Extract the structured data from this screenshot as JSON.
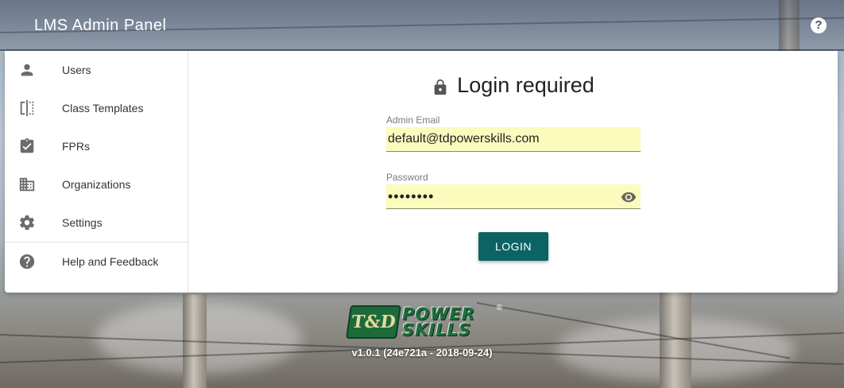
{
  "app": {
    "title": "LMS Admin Panel"
  },
  "header": {
    "help_icon": "help-circle-icon"
  },
  "sidebar": {
    "items": [
      {
        "label": "Users",
        "icon": "person-icon"
      },
      {
        "label": "Class Templates",
        "icon": "template-icon"
      },
      {
        "label": "FPRs",
        "icon": "clipboard-check-icon"
      },
      {
        "label": "Organizations",
        "icon": "building-icon"
      },
      {
        "label": "Settings",
        "icon": "gear-icon"
      }
    ],
    "footer_item": {
      "label": "Help and Feedback",
      "icon": "help-circle-icon"
    }
  },
  "login": {
    "title": "Login required",
    "email_label": "Admin Email",
    "email_value": "default@tdpowerskills.com",
    "password_label": "Password",
    "password_value": "••••••••",
    "button_label": "LOGIN"
  },
  "brand": {
    "mark": "T&D",
    "line1": "POWER",
    "line2": "SKILLS",
    "reg": "®"
  },
  "version": "v1.0.1 (24e721a - 2018-09-24)",
  "colors": {
    "primary": "#0c6363",
    "autofill": "#fafbbd",
    "brand_green": "#1e6f3e"
  }
}
